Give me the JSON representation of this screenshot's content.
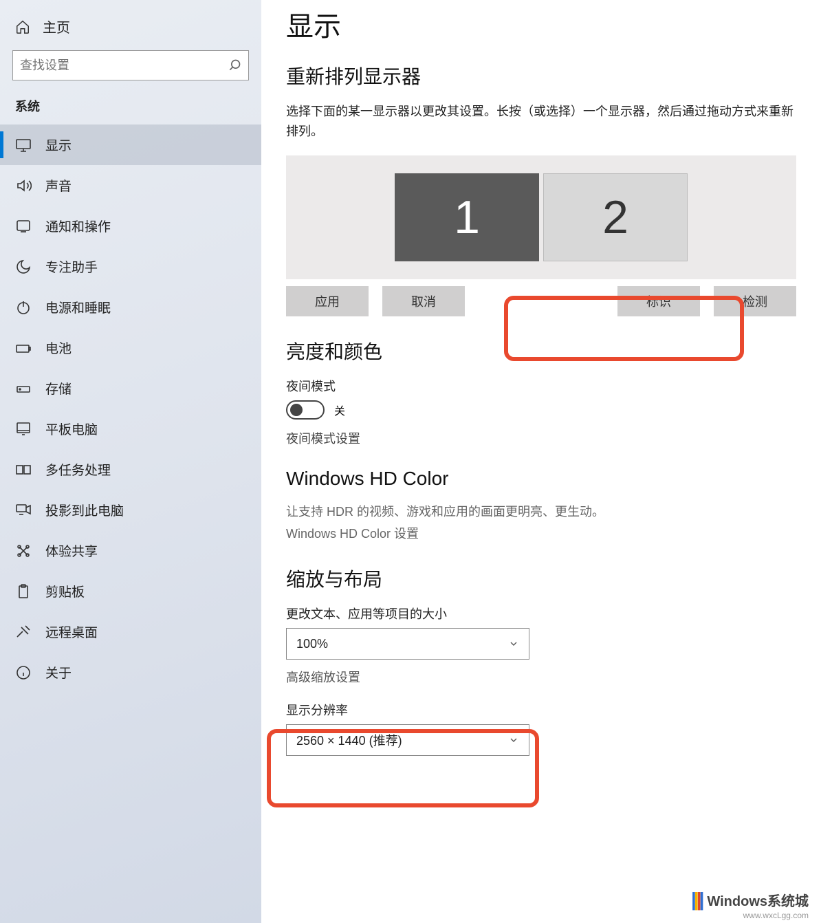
{
  "header": {
    "home": "主页"
  },
  "search": {
    "placeholder": "查找设置"
  },
  "sidebar": {
    "section": "系统",
    "items": [
      {
        "label": "显示"
      },
      {
        "label": "声音"
      },
      {
        "label": "通知和操作"
      },
      {
        "label": "专注助手"
      },
      {
        "label": "电源和睡眠"
      },
      {
        "label": "电池"
      },
      {
        "label": "存储"
      },
      {
        "label": "平板电脑"
      },
      {
        "label": "多任务处理"
      },
      {
        "label": "投影到此电脑"
      },
      {
        "label": "体验共享"
      },
      {
        "label": "剪贴板"
      },
      {
        "label": "远程桌面"
      },
      {
        "label": "关于"
      }
    ]
  },
  "main": {
    "title": "显示",
    "rearrange": {
      "heading": "重新排列显示器",
      "desc": "选择下面的某一显示器以更改其设置。长按（或选择）一个显示器，然后通过拖动方式来重新排列。",
      "monitor1": "1",
      "monitor2": "2",
      "apply": "应用",
      "cancel": "取消",
      "identify": "标识",
      "detect": "检测"
    },
    "brightness": {
      "heading": "亮度和颜色",
      "night": "夜间模式",
      "night_state": "关",
      "night_link": "夜间模式设置"
    },
    "hdcolor": {
      "heading": "Windows HD Color",
      "desc": "让支持 HDR 的视频、游戏和应用的画面更明亮、更生动。",
      "link": "Windows HD Color 设置"
    },
    "scale": {
      "heading": "缩放与布局",
      "size_label": "更改文本、应用等项目的大小",
      "size_value": "100%",
      "adv": "高级缩放设置",
      "res_label": "显示分辨率",
      "res_value": "2560 × 1440 (推荐)"
    }
  },
  "watermark": {
    "name": "Windows系统城",
    "url": "www.wxcLgg.com"
  }
}
